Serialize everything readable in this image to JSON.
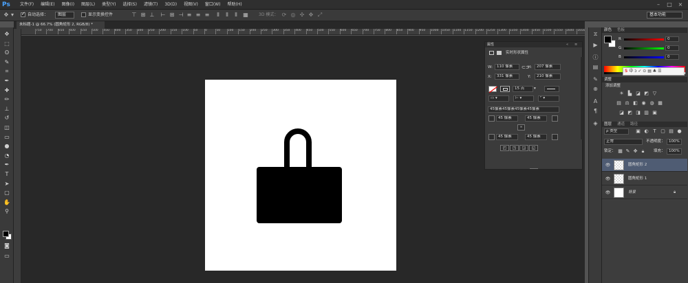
{
  "app": {
    "logo": "Ps"
  },
  "menubar": {
    "items": [
      "文件(F)",
      "编辑(E)",
      "图像(I)",
      "图层(L)",
      "类型(Y)",
      "选择(S)",
      "滤镜(T)",
      "3D(D)",
      "视图(V)",
      "窗口(W)",
      "帮助(H)"
    ]
  },
  "options": {
    "auto_select_label": "自动选择：",
    "auto_select_value": "图层",
    "show_transform_label": "显示变换控件",
    "mode3d_label": "3D 模式：",
    "workspace": "基本功能"
  },
  "document": {
    "tab_label": "未标题-1 @ 66.7% (圆角矩形 2, RGB/8) *",
    "ruler_ticks": [
      "750",
      "700",
      "650",
      "600",
      "550",
      "500",
      "450",
      "400",
      "350",
      "300",
      "250",
      "200",
      "150",
      "100",
      "50",
      "0",
      "50",
      "100",
      "150",
      "200",
      "250",
      "300",
      "350",
      "400",
      "450",
      "500",
      "550",
      "600",
      "650",
      "700",
      "750",
      "800",
      "850",
      "900",
      "950",
      "1000",
      "1050",
      "1100",
      "1150",
      "1200",
      "1250",
      "1300",
      "1350",
      "1400",
      "1450",
      "1500",
      "1550",
      "1600",
      "1650"
    ]
  },
  "properties": {
    "panel_tab": "属性",
    "title": "实时形状属性",
    "w_label": "W:",
    "w_value": "110 像素",
    "h_label": "H:",
    "h_value": "207 像素",
    "x_label": "X:",
    "x_value": "331 像素",
    "y_label": "Y:",
    "y_value": "210 像素",
    "stroke_width": "15 点",
    "corner_summary": "45像素45像素45像素45像素",
    "corner_tl": "45 像素",
    "corner_tr": "45 像素",
    "corner_bl": "45 像素",
    "corner_br": "45 像素"
  },
  "color_panel": {
    "tab_color": "颜色",
    "tab_swatches": "色板",
    "r_label": "R",
    "r_value": "0",
    "g_label": "G",
    "g_value": "0",
    "b_label": "B",
    "b_value": "0"
  },
  "adjustments": {
    "tab": "调整",
    "add_label": "添加调整"
  },
  "layers": {
    "tab_layers": "图层",
    "tab_channels": "通道",
    "tab_paths": "路径",
    "filter_kind": "ρ 类型",
    "blend_mode": "正常",
    "opacity_label": "不透明度：",
    "opacity_value": "100%",
    "lock_label": "锁定：",
    "fill_label": "填充：",
    "fill_value": "100%",
    "items": [
      {
        "name": "圆角矩形 2"
      },
      {
        "name": "圆角矩形 1"
      },
      {
        "name": "背景"
      }
    ]
  },
  "colors": {
    "accent_blue": "#4aa3ff",
    "selected_layer": "#4f5c73"
  }
}
